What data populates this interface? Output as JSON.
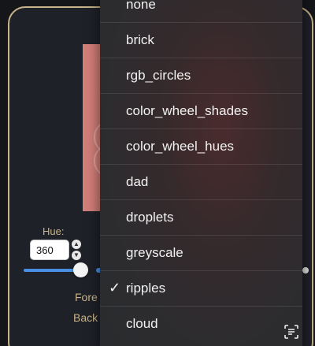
{
  "hue": {
    "label": "Hue:",
    "value": "360",
    "slider_fraction": 1.0
  },
  "labels": {
    "fore_partial": "Fore",
    "back_partial": "Back"
  },
  "menu": {
    "items": [
      {
        "label": "none",
        "checked": false
      },
      {
        "label": "brick",
        "checked": false
      },
      {
        "label": "rgb_circles",
        "checked": false
      },
      {
        "label": "color_wheel_shades",
        "checked": false
      },
      {
        "label": "color_wheel_hues",
        "checked": false
      },
      {
        "label": "dad",
        "checked": false
      },
      {
        "label": "droplets",
        "checked": false
      },
      {
        "label": "greyscale",
        "checked": false
      },
      {
        "label": "ripples",
        "checked": true
      },
      {
        "label": "cloud",
        "checked": false
      }
    ],
    "check_glyph": "✓"
  },
  "colors": {
    "accent": "#4a90e2",
    "gold": "#c9b489",
    "preview": "#d37f7a"
  },
  "icons": {
    "scan": "scan-text-icon"
  }
}
